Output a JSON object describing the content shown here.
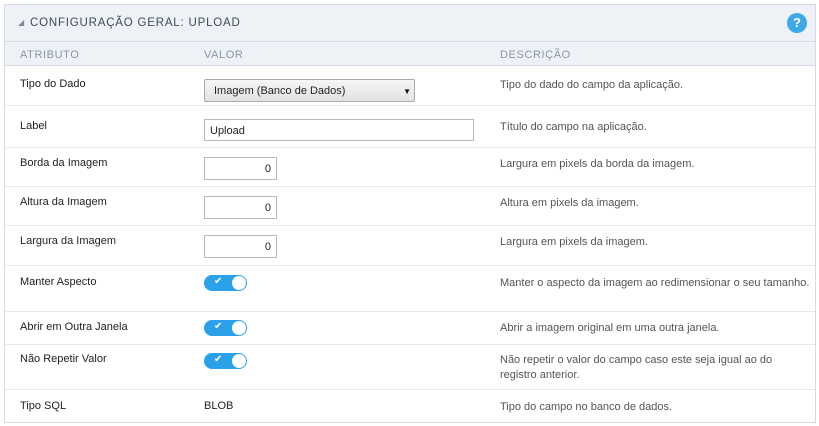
{
  "panel": {
    "title": "CONFIGURAÇÃO GERAL: UPLOAD",
    "help_icon_text": "?",
    "collapse_icon": "triangle-icon"
  },
  "columns": {
    "attribute": "ATRIBUTO",
    "value": "VALOR",
    "description": "DESCRIÇÃO"
  },
  "rows": [
    {
      "label": "Tipo do Dado",
      "value": "Imagem (Banco de Dados)",
      "description": "Tipo do dado do campo da aplicação."
    },
    {
      "label": "Label",
      "value": "Upload",
      "description": "Título do campo na aplicação."
    },
    {
      "label": "Borda da Imagem",
      "value": "0",
      "description": "Largura em pixels da borda da imagem."
    },
    {
      "label": "Altura da Imagem",
      "value": "0",
      "description": "Altura em pixels da imagem."
    },
    {
      "label": "Largura da Imagem",
      "value": "0",
      "description": "Largura em pixels da imagem."
    },
    {
      "label": "Manter Aspecto",
      "value": "on",
      "description": "Manter o aspecto da imagem ao redimensionar o seu tamanho."
    },
    {
      "label": "Abrir em Outra Janela",
      "value": "on",
      "description": "Abrir a imagem original em uma outra janela."
    },
    {
      "label": "Não Repetir Valor",
      "value": "on",
      "description": "Não repetir o valor do campo caso este seja igual ao do registro anterior."
    },
    {
      "label": "Tipo SQL",
      "value": "BLOB",
      "description": "Tipo do campo no banco de dados."
    }
  ],
  "toggle_check": "✔",
  "select_arrow": "▼",
  "colors": {
    "accent": "#2aa1e8",
    "header_bg": "#eef1f5"
  }
}
